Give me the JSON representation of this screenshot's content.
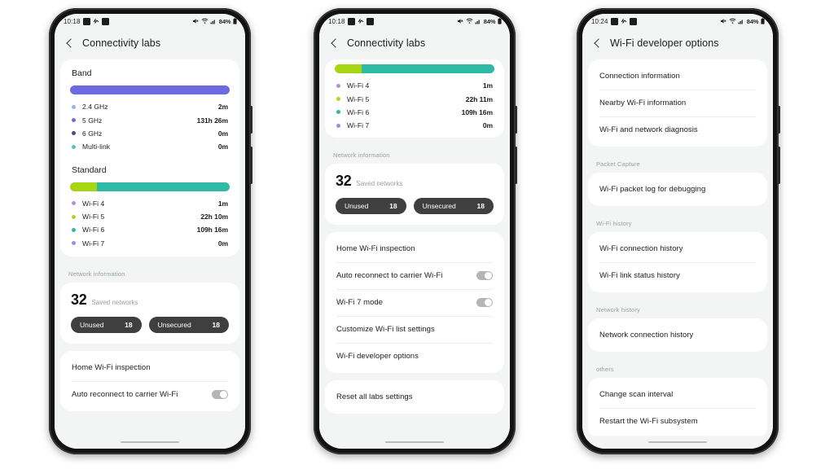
{
  "colors": {
    "band_bar": "#6c6ce0",
    "standard_green": "#a8d512",
    "standard_teal": "#2dbaa6",
    "dot_24ghz": "#8fb5ef",
    "dot_5ghz": "#6c6ce0",
    "dot_6ghz": "#4a4a8f",
    "dot_multilink": "#4fc9b6",
    "dot_wifi4": "#b98de0",
    "dot_wifi5": "#b3d22e",
    "dot_wifi6": "#2dbaa6",
    "dot_wifi7": "#9a8de8",
    "chip_bg": "#3f3f3f",
    "screen_bg": "#f3f5f4",
    "card_bg": "#ffffff"
  },
  "phones": [
    {
      "id": "phone-1",
      "statusbar": {
        "time": "10:18",
        "left_icons": [
          "screenshot-icon",
          "dnd-icon",
          "email-icon"
        ],
        "right_icons": [
          "mute-icon",
          "wifi-icon",
          "signal-icon"
        ],
        "battery": "84%"
      },
      "appbar": {
        "title": "Connectivity labs",
        "back_icon": "back-chevron-icon"
      },
      "band": {
        "title": "Band",
        "segments": [
          {
            "name": "5 GHz",
            "percent": 100,
            "color": "#6c6ce0"
          }
        ],
        "rows": [
          {
            "label": "2.4 GHz",
            "value": "2m",
            "color": "#8fb5ef"
          },
          {
            "label": "5 GHz",
            "value": "131h 26m",
            "color": "#6c6ce0"
          },
          {
            "label": "6 GHz",
            "value": "0m",
            "color": "#4a4a8f"
          },
          {
            "label": "Multi-link",
            "value": "0m",
            "color": "#4fc9b6"
          }
        ]
      },
      "standard": {
        "title": "Standard",
        "segments": [
          {
            "name": "Wi-Fi 5",
            "percent": 17,
            "color": "#a8d512"
          },
          {
            "name": "Wi-Fi 6",
            "percent": 83,
            "color": "#2dbaa6"
          }
        ],
        "rows": [
          {
            "label": "Wi-Fi 4",
            "value": "1m",
            "color": "#b98de0"
          },
          {
            "label": "Wi-Fi 5",
            "value": "22h 10m",
            "color": "#b3d22e"
          },
          {
            "label": "Wi-Fi 6",
            "value": "109h 16m",
            "color": "#2dbaa6"
          },
          {
            "label": "Wi-Fi 7",
            "value": "0m",
            "color": "#9a8de8"
          }
        ]
      },
      "network_information": {
        "header": "Network information",
        "count": "32",
        "count_label": "Saved networks",
        "chips": [
          {
            "label": "Unused",
            "value": "18"
          },
          {
            "label": "Unsecured",
            "value": "18"
          }
        ]
      },
      "settings_rows": [
        {
          "label": "Home Wi-Fi inspection",
          "toggle": null
        },
        {
          "label": "Auto reconnect to carrier Wi-Fi",
          "toggle": "on"
        }
      ]
    },
    {
      "id": "phone-2",
      "statusbar": {
        "time": "10:18",
        "left_icons": [
          "screenshot-icon",
          "dnd-icon",
          "email-icon"
        ],
        "right_icons": [
          "mute-icon",
          "wifi-icon",
          "signal-icon"
        ],
        "battery": "84%"
      },
      "appbar": {
        "title": "Connectivity labs",
        "back_icon": "back-chevron-icon"
      },
      "standard": {
        "segments": [
          {
            "name": "Wi-Fi 5",
            "percent": 17,
            "color": "#a8d512"
          },
          {
            "name": "Wi-Fi 6",
            "percent": 83,
            "color": "#2dbaa6"
          }
        ],
        "rows": [
          {
            "label": "Wi-Fi 4",
            "value": "1m",
            "color": "#b98de0"
          },
          {
            "label": "Wi-Fi 5",
            "value": "22h 11m",
            "color": "#b3d22e"
          },
          {
            "label": "Wi-Fi 6",
            "value": "109h 16m",
            "color": "#2dbaa6"
          },
          {
            "label": "Wi-Fi 7",
            "value": "0m",
            "color": "#9a8de8"
          }
        ]
      },
      "network_information": {
        "header": "Network information",
        "count": "32",
        "count_label": "Saved networks",
        "chips": [
          {
            "label": "Unused",
            "value": "18"
          },
          {
            "label": "Unsecured",
            "value": "18"
          }
        ]
      },
      "settings_rows": [
        {
          "label": "Home Wi-Fi inspection",
          "toggle": null
        },
        {
          "label": "Auto reconnect to carrier Wi-Fi",
          "toggle": "on"
        },
        {
          "label": "Wi-Fi 7 mode",
          "toggle": "on"
        },
        {
          "label": "Customize Wi-Fi list settings",
          "toggle": null
        },
        {
          "label": "Wi-Fi developer options",
          "toggle": null
        }
      ],
      "reset_row": {
        "label": "Reset all labs settings"
      }
    },
    {
      "id": "phone-3",
      "statusbar": {
        "time": "10:24",
        "left_icons": [
          "screenshot-icon",
          "dnd-icon",
          "email-icon"
        ],
        "right_icons": [
          "mute-icon",
          "wifi-icon",
          "signal-icon"
        ],
        "battery": "84%"
      },
      "appbar": {
        "title": "Wi-Fi developer options",
        "back_icon": "back-chevron-icon"
      },
      "groups": [
        {
          "header": null,
          "rows": [
            {
              "label": "Connection information"
            },
            {
              "label": "Nearby Wi-Fi information"
            },
            {
              "label": "Wi-Fi and network diagnosis"
            }
          ]
        },
        {
          "header": "Packet Capture",
          "rows": [
            {
              "label": "Wi-Fi packet log for debugging"
            }
          ]
        },
        {
          "header": "Wi-Fi history",
          "rows": [
            {
              "label": "Wi-Fi connection history"
            },
            {
              "label": "Wi-Fi link status history"
            }
          ]
        },
        {
          "header": "Network history",
          "rows": [
            {
              "label": "Network connection history"
            }
          ]
        },
        {
          "header": "others",
          "rows": [
            {
              "label": "Change scan interval"
            },
            {
              "label": "Restart the Wi-Fi subsystem"
            }
          ]
        }
      ]
    }
  ]
}
